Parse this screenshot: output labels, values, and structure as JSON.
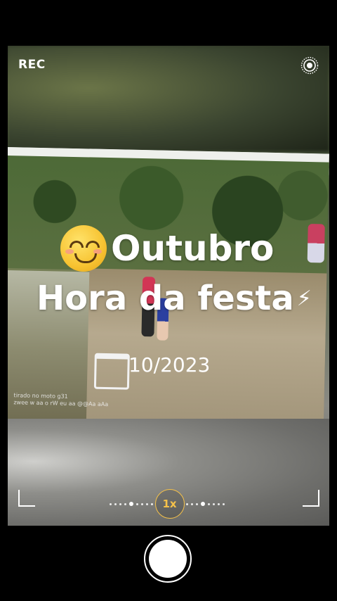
{
  "status": {
    "rec_label": "REC",
    "live_icon": "live-photo-icon"
  },
  "overlay": {
    "emoji": "smiling-face-emoji",
    "line1": "Outubro",
    "line2": "Hora da festa",
    "bolt": "⚡",
    "date": "10/2023"
  },
  "photo": {
    "watermark_line1": "tirado no moto g31",
    "watermark_line2": "zwee w aa o rW eu aa @@Aa aAa"
  },
  "zoom": {
    "label": "1x",
    "accent": "#f6c24a"
  },
  "camera": {
    "shutter_icon": "shutter-button"
  }
}
